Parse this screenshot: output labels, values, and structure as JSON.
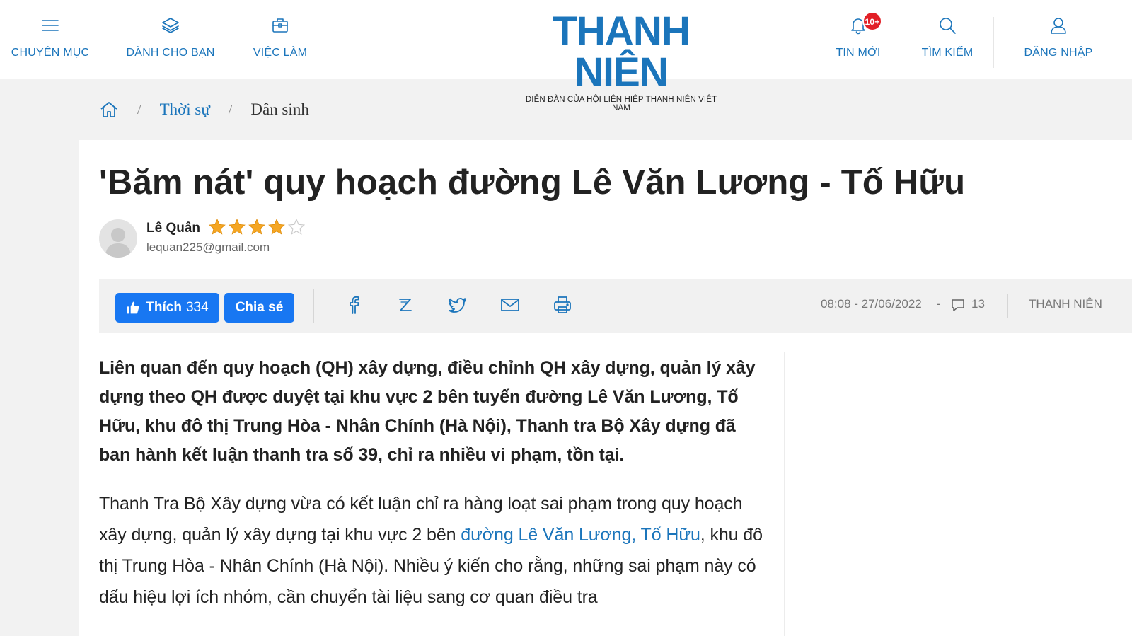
{
  "header": {
    "nav_left": [
      {
        "label": "CHUYÊN MỤC",
        "icon": "menu-icon"
      },
      {
        "label": "DÀNH CHO BẠN",
        "icon": "layers-icon"
      },
      {
        "label": "VIỆC LÀM",
        "icon": "briefcase-icon"
      }
    ],
    "logo": {
      "word": "THANH NIÊN",
      "tagline": "DIỄN ĐÀN CỦA HỘI LIÊN HIỆP THANH NIÊN VIỆT NAM"
    },
    "nav_right": [
      {
        "label": "TIN MỚI",
        "icon": "bell-icon",
        "badge": "10+"
      },
      {
        "label": "TÌM KIẾM",
        "icon": "search-icon"
      },
      {
        "label": "ĐĂNG NHẬP",
        "icon": "user-icon"
      }
    ]
  },
  "breadcrumb": {
    "home_icon": "home-icon",
    "separator": "/",
    "items": [
      "Thời sự",
      "Dân sinh"
    ]
  },
  "article": {
    "title": "'Băm nát' quy hoạch đường Lê Văn Lương - Tố Hữu",
    "author": {
      "name": "Lê Quân",
      "email": "lequan225@gmail.com",
      "rating": 4,
      "rating_max": 5
    },
    "share": {
      "like_label": "Thích",
      "like_count": "334",
      "share_label": "Chia sẻ",
      "icons": [
        "facebook-icon",
        "zalo-icon",
        "twitter-icon",
        "mail-icon",
        "print-icon"
      ]
    },
    "meta": {
      "datetime": "08:08 - 27/06/2022",
      "dash": "-",
      "comments": "13",
      "source": "THANH NIÊN"
    },
    "sapo": "Liên quan đến quy hoạch (QH) xây dựng, điều chỉnh QH xây dựng, quản lý xây dựng theo QH được duyệt tại khu vực 2 bên tuyến đường Lê Văn Lương, Tố Hữu, khu đô thị Trung Hòa - Nhân Chính (Hà Nội), Thanh tra Bộ Xây dựng đã ban hành kết luận thanh tra số 39, chỉ ra nhiều vi phạm, tồn tại.",
    "para1": {
      "before": "Thanh Tra Bộ Xây dựng vừa có kết luận chỉ ra hàng loạt sai phạm trong quy hoạch xây dựng, quản lý xây dựng tại khu vực 2 bên ",
      "link": "đường Lê Văn Lương, Tố Hữu",
      "after": ", khu đô thị Trung Hòa - Nhân Chính (Hà Nội). Nhiều ý kiến cho rằng, những sai phạm này có dấu hiệu lợi ích nhóm, cần chuyển tài liệu sang cơ quan điều tra"
    }
  },
  "colors": {
    "brand": "#1b75bb",
    "facebook": "#1877f2",
    "badge": "#e21f26",
    "star": "#f5a623"
  }
}
